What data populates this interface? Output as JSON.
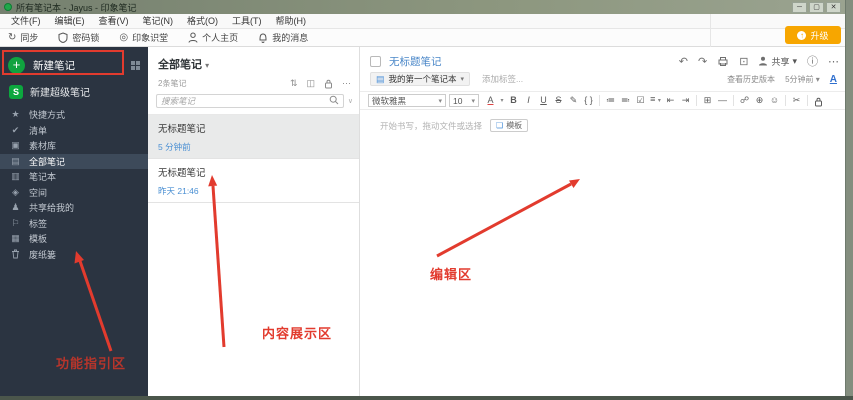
{
  "window": {
    "title": "所有笔记本 - Jayus - 印象笔记",
    "upgrade_label": "升级"
  },
  "menu": {
    "items": [
      "文件(F)",
      "编辑(E)",
      "查看(V)",
      "笔记(N)",
      "格式(O)",
      "工具(T)",
      "帮助(H)"
    ]
  },
  "toolbar": {
    "sync": "同步",
    "password_lock": "密码锁",
    "classroom": "印象识堂",
    "profile": "个人主页",
    "messages": "我的消息"
  },
  "sidebar": {
    "new_note": "新建笔记",
    "new_super_note": "新建超级笔记",
    "items": [
      {
        "label": "快捷方式"
      },
      {
        "label": "清单"
      },
      {
        "label": "素材库"
      },
      {
        "label": "全部笔记",
        "selected": true
      },
      {
        "label": "笔记本"
      },
      {
        "label": "空间"
      },
      {
        "label": "共享给我的"
      },
      {
        "label": "标签"
      },
      {
        "label": "模板"
      },
      {
        "label": "废纸篓"
      }
    ]
  },
  "notelist": {
    "header": "全部笔记",
    "count": "2条笔记",
    "search_placeholder": "搜索笔记",
    "notes": [
      {
        "title": "无标题笔记",
        "time": "5 分钟前",
        "selected": true
      },
      {
        "title": "无标题笔记",
        "time": "昨天 21:46",
        "selected": false
      }
    ]
  },
  "editor": {
    "title": "无标题笔记",
    "notebook": "我的第一个笔记本",
    "add_tag": "添加标签...",
    "share": "共享",
    "history": "查看历史版本",
    "last_edit": "5分钟前",
    "font_size_label": "A",
    "font_name": "微软雅黑",
    "font_size": "10",
    "placeholder": "开始书写，拖动文件或选择",
    "template_chip": "模板"
  },
  "annotations": {
    "color": "#e23b2e",
    "labels": [
      {
        "text": "功能指引区"
      },
      {
        "text": "内容展示区"
      },
      {
        "text": "编辑区"
      }
    ]
  },
  "icons": {
    "plus": "+",
    "super_s": "S",
    "star": "★",
    "check": "✔",
    "material": "▣",
    "all_notes": "▤",
    "notebook": "▥",
    "space": "◈",
    "shared": "♟",
    "tag": "⚐",
    "template": "▦",
    "sync": "↻",
    "megaphone": "◎",
    "upgrade_dot": "↑",
    "sort": "⇅",
    "cards": "◫",
    "dots": "⋯",
    "chevron_down": "▾",
    "search_caret": "∨",
    "undo": "↶",
    "redo": "↷",
    "display": "⊡",
    "info": "ⓘ",
    "font_color": "A",
    "bold": "B",
    "italic": "I",
    "underline": "U",
    "strike": "S",
    "pen": "✎",
    "code": "{ }",
    "ul": "≔",
    "ol": "≕",
    "todo": "☑",
    "align": "≡",
    "outdent": "⇤",
    "indent": "⇥",
    "table": "⊞",
    "hr": "—",
    "link": "☍",
    "insert": "⊕",
    "emoji": "☺",
    "cut": "✂",
    "notebook_chip": "▤",
    "template_chip_icon": "❏",
    "min": "─",
    "max": "▢",
    "close": "✕"
  }
}
